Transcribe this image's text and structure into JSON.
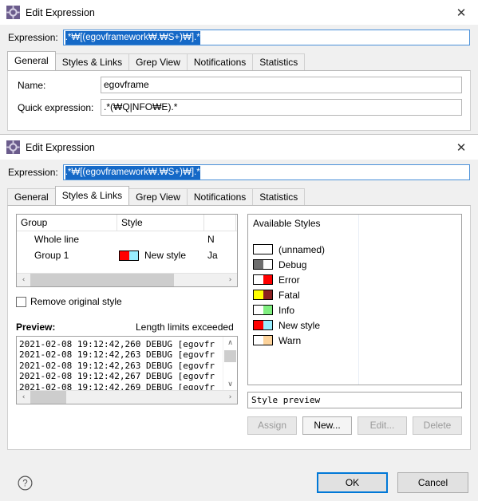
{
  "dialog_back": {
    "title": "Edit Expression",
    "icon": "app-gear-icon",
    "close_icon": "✕",
    "expression": {
      "label": "Expression:",
      "value": ".*₩[(egovframework₩.₩S+)₩].*",
      "selected": true
    },
    "tabs": [
      {
        "label": "General",
        "active": true
      },
      {
        "label": "Styles & Links",
        "active": false
      },
      {
        "label": "Grep View",
        "active": false
      },
      {
        "label": "Notifications",
        "active": false
      },
      {
        "label": "Statistics",
        "active": false
      }
    ],
    "fields": [
      {
        "label": "Name:",
        "value": "egovframe"
      },
      {
        "label": "Quick expression:",
        "value": ".*(₩Q|NFO₩E).*"
      }
    ]
  },
  "dialog_front": {
    "title": "Edit Expression",
    "icon": "app-gear-icon",
    "close_icon": "✕",
    "expression": {
      "label": "Expression:",
      "value": ".*₩[(egovframework₩.₩S+)₩].*",
      "selected": true
    },
    "tabs": [
      {
        "label": "General",
        "active": false
      },
      {
        "label": "Styles & Links",
        "active": true
      },
      {
        "label": "Grep View",
        "active": false
      },
      {
        "label": "Notifications",
        "active": false
      },
      {
        "label": "Statistics",
        "active": false
      }
    ],
    "group_table": {
      "columns": [
        "Group",
        "Style",
        ""
      ],
      "rows": [
        {
          "group": "Whole line",
          "style_name": "",
          "swatch": null,
          "col3": "N"
        },
        {
          "group": "Group 1",
          "style_name": "New style",
          "swatch": {
            "fg": "#ff0000",
            "bg": "#99eeff"
          },
          "col3": "Ja"
        }
      ],
      "hscroll": {
        "left_arrow": "‹",
        "right_arrow": "›"
      }
    },
    "remove_original_style": {
      "label": "Remove original style",
      "checked": false
    },
    "preview": {
      "title": "Preview:",
      "note": "Length limits exceeded",
      "lines": [
        "2021-02-08 19:12:42,260 DEBUG [egovfr",
        "2021-02-08 19:12:42,263 DEBUG [egovfr",
        "2021-02-08 19:12:42,263 DEBUG [egovfr",
        "2021-02-08 19:12:42,267 DEBUG [egovfr",
        "2021-02-08 19:12:42,269 DEBUG [egovfr"
      ],
      "vscroll": {
        "up_arrow": "∧",
        "down_arrow": "∨"
      },
      "hscroll": {
        "left_arrow": "‹",
        "right_arrow": "›"
      }
    },
    "available_styles": {
      "header": "Available Styles",
      "items": [
        {
          "label": "(unnamed)",
          "fg": "#ffffff",
          "bg": "#ffffff"
        },
        {
          "label": "Debug",
          "fg": "#6e6e6e",
          "bg": "#ffffff"
        },
        {
          "label": "Error",
          "fg": "#ffffff",
          "bg": "#ff0000"
        },
        {
          "label": "Fatal",
          "fg": "#ffff00",
          "bg": "#8b2020"
        },
        {
          "label": "Info",
          "fg": "#ffffff",
          "bg": "#80ef80"
        },
        {
          "label": "New style",
          "fg": "#ff0000",
          "bg": "#99eeff"
        },
        {
          "label": "Warn",
          "fg": "#ffffff",
          "bg": "#fcd29a"
        }
      ]
    },
    "style_preview": {
      "value": "Style preview"
    },
    "style_buttons": [
      {
        "label": "Assign",
        "enabled": false
      },
      {
        "label": "New...",
        "enabled": true
      },
      {
        "label": "Edit...",
        "enabled": false
      },
      {
        "label": "Delete",
        "enabled": false
      }
    ],
    "footer": {
      "help_icon": "question-mark-icon",
      "ok": "OK",
      "cancel": "Cancel"
    }
  }
}
